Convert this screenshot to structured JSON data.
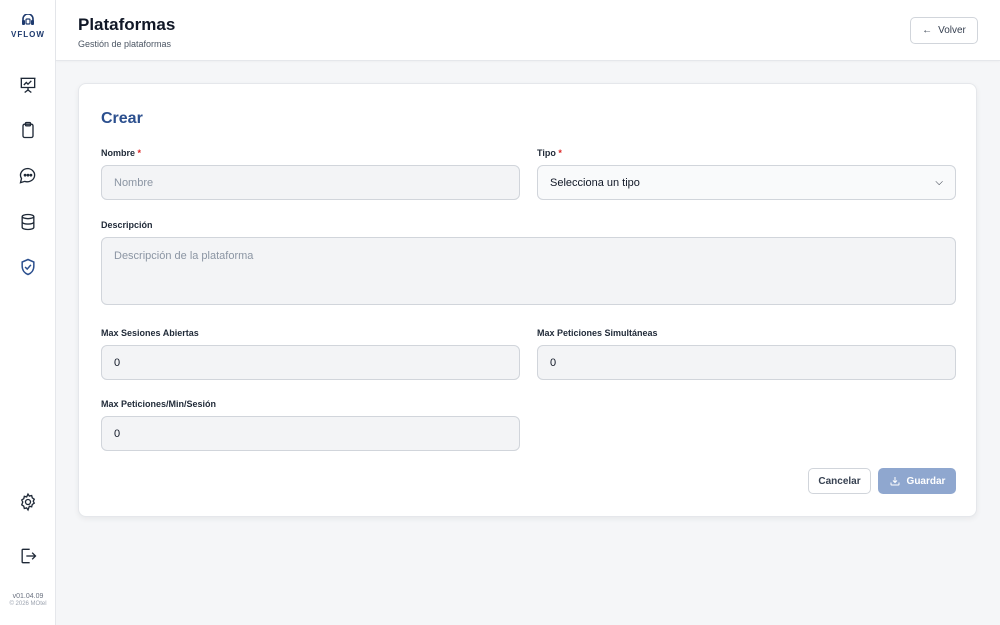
{
  "brand": {
    "name": "VFLOW"
  },
  "sidebar": {
    "items": [
      {
        "icon": "presentation-chart-icon"
      },
      {
        "icon": "clipboard-icon"
      },
      {
        "icon": "chat-bubble-icon"
      },
      {
        "icon": "database-icon"
      },
      {
        "icon": "shield-check-icon",
        "active": true
      }
    ],
    "bottom": [
      {
        "icon": "gear-icon"
      },
      {
        "icon": "logout-icon"
      }
    ],
    "version": "v01.04.09",
    "copyright": "© 2026 MOtel"
  },
  "header": {
    "title": "Plataformas",
    "subtitle": "Gestión de plataformas",
    "back_label": "Volver"
  },
  "form": {
    "title": "Crear",
    "required_mark": "*",
    "nombre": {
      "label": "Nombre",
      "placeholder": "Nombre"
    },
    "tipo": {
      "label": "Tipo",
      "value": "Selecciona un tipo"
    },
    "descripcion": {
      "label": "Descripción",
      "placeholder": "Descripción de la plataforma"
    },
    "max_sesiones": {
      "label": "Max Sesiones Abiertas",
      "value": "0"
    },
    "max_peticiones_sim": {
      "label": "Max Peticiones Simultáneas",
      "value": "0"
    },
    "max_peticiones_min": {
      "label": "Max Peticiones/Min/Sesión",
      "value": "0"
    },
    "cancel_label": "Cancelar",
    "save_label": "Guardar"
  },
  "colors": {
    "accent": "#2b4f8e",
    "save_disabled": "#8fa7cf",
    "required": "#dc2626"
  }
}
